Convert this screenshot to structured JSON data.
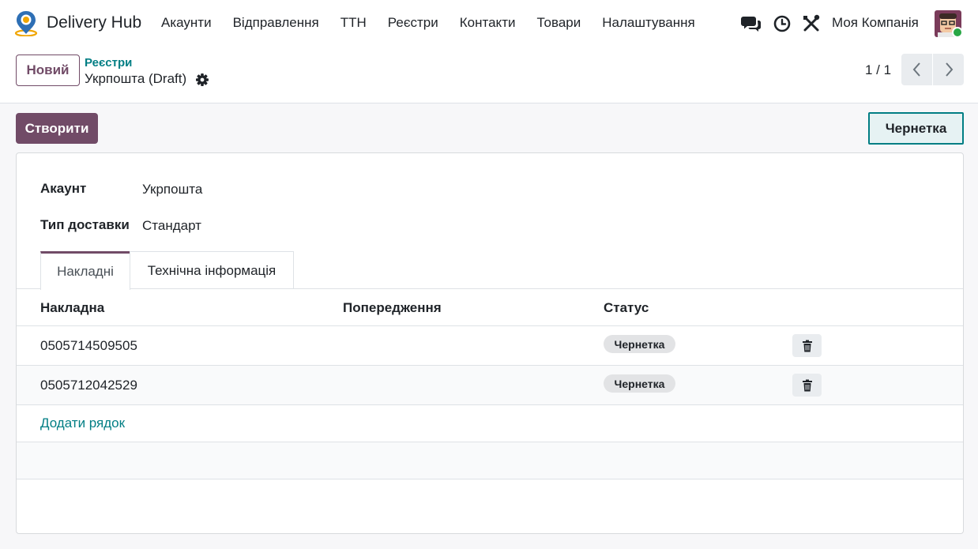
{
  "navbar": {
    "app_name": "Delivery Hub",
    "menu": [
      "Акаунти",
      "Відправлення",
      "ТТН",
      "Реєстри",
      "Контакти",
      "Товари",
      "Налаштування"
    ],
    "company": "Моя Компанія"
  },
  "control_panel": {
    "new_button": "Новий",
    "breadcrumb": "Реєстри",
    "record_title": "Укрпошта (Draft)",
    "pager": "1 / 1"
  },
  "actions": {
    "create_button": "Створити",
    "status": "Чернетка"
  },
  "form": {
    "fields": [
      {
        "label": "Акаунт",
        "value": "Укрпошта"
      },
      {
        "label": "Тип доставки",
        "value": "Стандарт"
      }
    ],
    "tabs": [
      {
        "label": "Накладні",
        "active": true
      },
      {
        "label": "Технічна інформація",
        "active": false
      }
    ]
  },
  "table": {
    "headers": [
      "Накладна",
      "Попередження",
      "Статус"
    ],
    "rows": [
      {
        "number": "0505714509505",
        "warning": "",
        "status": "Чернетка"
      },
      {
        "number": "0505712042529",
        "warning": "",
        "status": "Чернетка"
      }
    ],
    "add_line": "Додати рядок"
  },
  "colors": {
    "brand": "#714b67",
    "accent": "#017e84"
  },
  "icons": [
    "location-pin-icon",
    "chat-icon",
    "clock-icon",
    "tools-icon",
    "gear-icon",
    "chevron-left-icon",
    "chevron-right-icon",
    "trash-icon"
  ]
}
